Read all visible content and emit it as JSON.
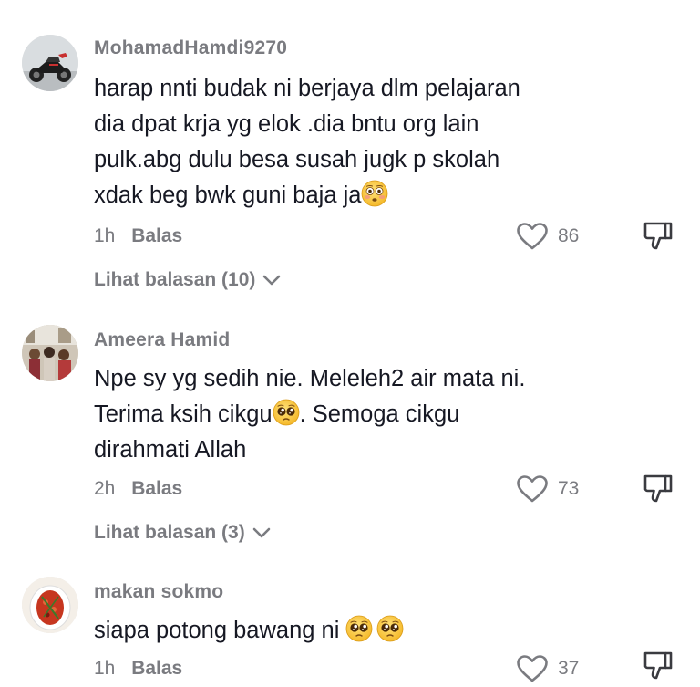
{
  "comments": [
    {
      "username": "MohamadHamdi9270",
      "lines": [
        "harap nnti budak ni berjaya dlm pelajaran",
        "dia dpat krja yg elok .dia bntu org lain",
        "pulk.abg dulu besa susah jugk p skolah",
        "xdak beg bwk guni baja ja"
      ],
      "emoji": "flushed-face",
      "time": "1h",
      "reply_label": "Balas",
      "likes": "86",
      "view_replies": "Lihat balasan (10)"
    },
    {
      "username": "Ameera Hamid",
      "lines": [
        "Npe sy yg sedih nie. Meleleh2 air mata ni.",
        "Terima ksih cikgu",
        ". Semoga cikgu",
        "dirahmati Allah"
      ],
      "emoji": "pleading-face",
      "time": "2h",
      "reply_label": "Balas",
      "likes": "73",
      "view_replies": "Lihat balasan (3)"
    },
    {
      "username": "makan sokmo",
      "lines": [
        "siapa potong bawang ni"
      ],
      "emoji": "pleading-face",
      "time": "1h",
      "reply_label": "Balas",
      "likes": "37"
    }
  ],
  "icons": {
    "like": "heart-outline-icon",
    "dislike": "thumbs-down-outline-icon",
    "expand": "chevron-down-icon"
  },
  "colors": {
    "text": "#161823",
    "muted": "#7a7b80",
    "emoji": "#f7c948"
  }
}
